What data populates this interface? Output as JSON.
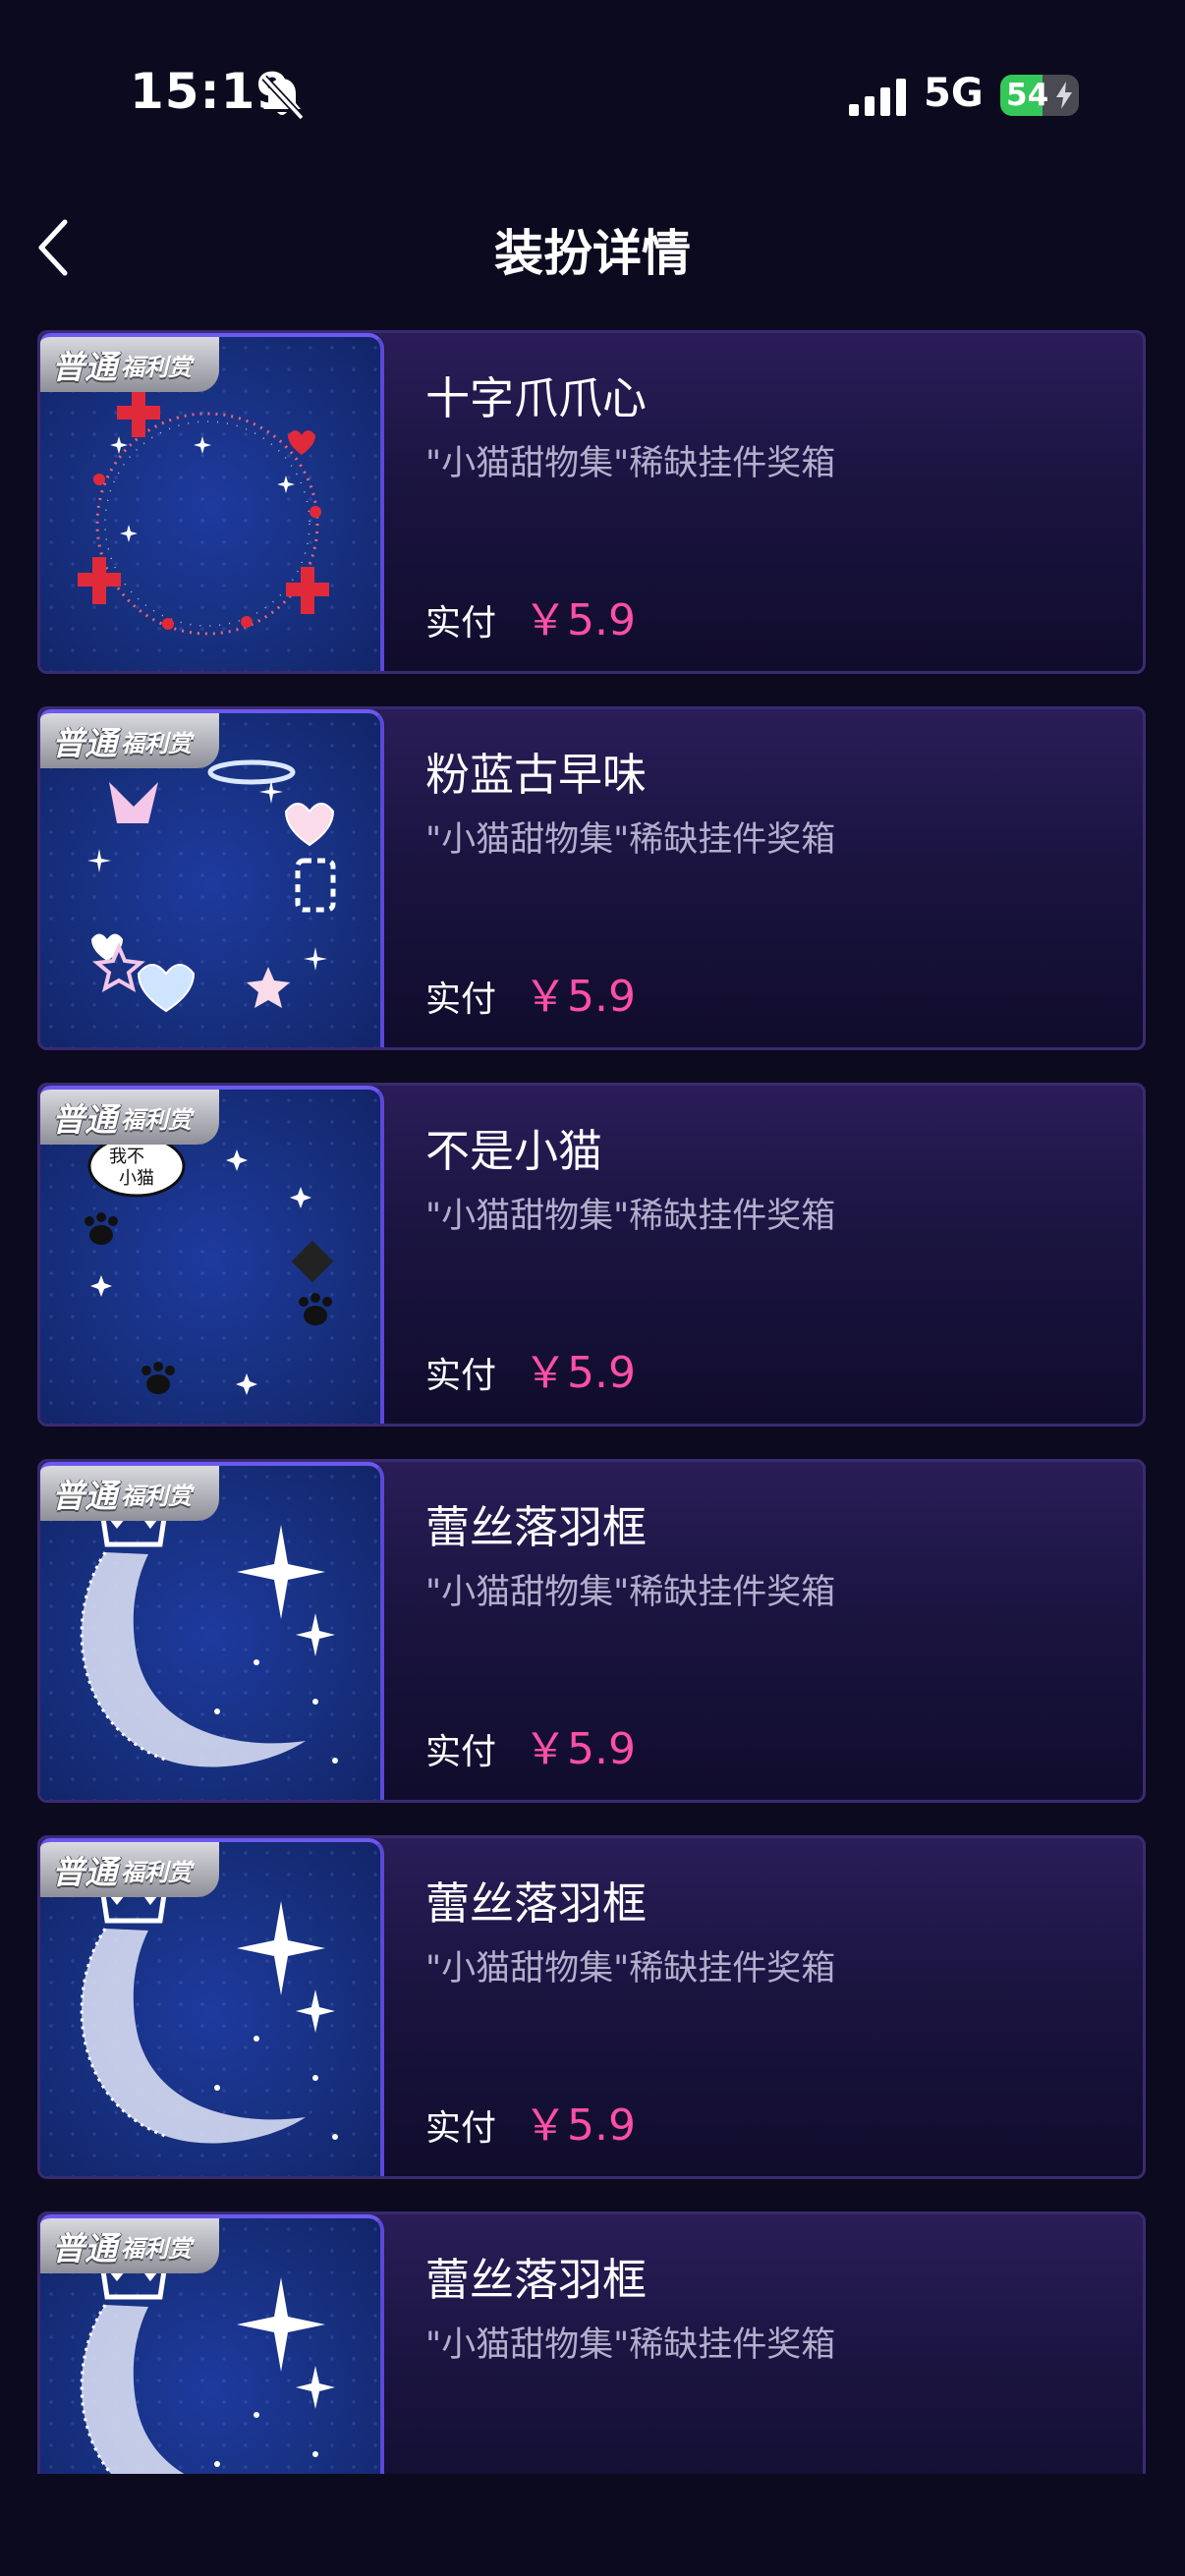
{
  "status_bar": {
    "time": "15:19",
    "network": "5G",
    "battery_level": "54"
  },
  "nav": {
    "title": "装扮详情"
  },
  "items": [
    {
      "name": "十字爪爪心",
      "desc": "\"小猫甜物集\"稀缺挂件奖箱",
      "pay_label": "实付",
      "price": "￥5.9",
      "badge_main": "普通",
      "badge_sub": "福利赏",
      "art": "cross-ring"
    },
    {
      "name": "粉蓝古早味",
      "desc": "\"小猫甜物集\"稀缺挂件奖箱",
      "pay_label": "实付",
      "price": "￥5.9",
      "badge_main": "普通",
      "badge_sub": "福利赏",
      "art": "pastel-ring"
    },
    {
      "name": "不是小猫",
      "desc": "\"小猫甜物集\"稀缺挂件奖箱",
      "pay_label": "实付",
      "price": "￥5.9",
      "badge_main": "普通",
      "badge_sub": "福利赏",
      "art": "paw-ring"
    },
    {
      "name": "蕾丝落羽框",
      "desc": "\"小猫甜物集\"稀缺挂件奖箱",
      "pay_label": "实付",
      "price": "￥5.9",
      "badge_main": "普通",
      "badge_sub": "福利赏",
      "art": "lace-moon"
    },
    {
      "name": "蕾丝落羽框",
      "desc": "\"小猫甜物集\"稀缺挂件奖箱",
      "pay_label": "实付",
      "price": "￥5.9",
      "badge_main": "普通",
      "badge_sub": "福利赏",
      "art": "lace-moon"
    },
    {
      "name": "蕾丝落羽框",
      "desc": "\"小猫甜物集\"稀缺挂件奖箱",
      "pay_label": "",
      "price": "",
      "badge_main": "普通",
      "badge_sub": "福利赏",
      "art": "lace-moon"
    }
  ],
  "colors": {
    "background": "#0c0a1e",
    "price": "#ff4fa6",
    "desc": "#b4aecd"
  }
}
